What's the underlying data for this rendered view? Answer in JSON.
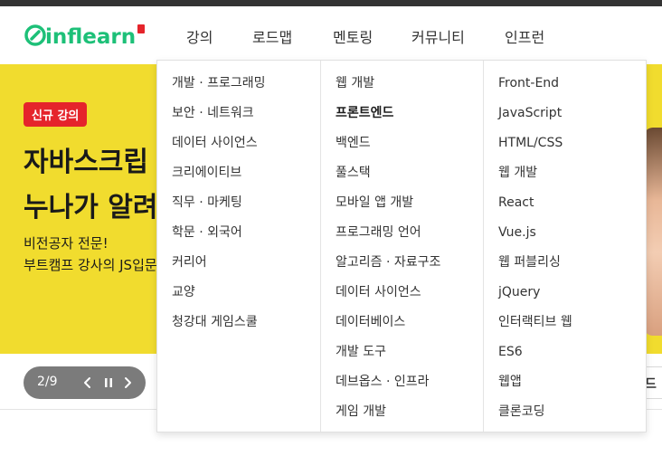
{
  "nav": {
    "logo_text": "inflearn",
    "items": [
      "강의",
      "로드맵",
      "멘토링",
      "커뮤니티",
      "인프런"
    ]
  },
  "hero": {
    "badge": "신규 강의",
    "title_line1": "자바스크립",
    "title_line2": "누나가 알려",
    "sub_line1": "비전공자 전문!",
    "sub_line2": "부트캠프 강사의 JS입문"
  },
  "pager": {
    "count": "2/9"
  },
  "right_pill_text": "드",
  "menu": {
    "col1": [
      "개발 · 프로그래밍",
      "보안 · 네트워크",
      "데이터 사이언스",
      "크리에이티브",
      "직무 · 마케팅",
      "학문 · 외국어",
      "커리어",
      "교양",
      "청강대 게임스쿨"
    ],
    "col2": [
      "웹 개발",
      "프론트엔드",
      "백엔드",
      "풀스택",
      "모바일 앱 개발",
      "프로그래밍 언어",
      "알고리즘 · 자료구조",
      "데이터 사이언스",
      "데이터베이스",
      "개발 도구",
      "데브옵스 · 인프라",
      "게임 개발"
    ],
    "col3": [
      "Front-End",
      "JavaScript",
      "HTML/CSS",
      "웹 개발",
      "React",
      "Vue.js",
      "웹 퍼블리싱",
      "jQuery",
      "인터랙티브 웹",
      "ES6",
      "웹앱",
      "클론코딩"
    ],
    "active_col2_index": 1
  },
  "colors": {
    "hero_bg": "#f1dc2e",
    "logo_green": "#1dc078",
    "badge_red": "#e5242b",
    "pager_bg": "#7b7b7b"
  }
}
